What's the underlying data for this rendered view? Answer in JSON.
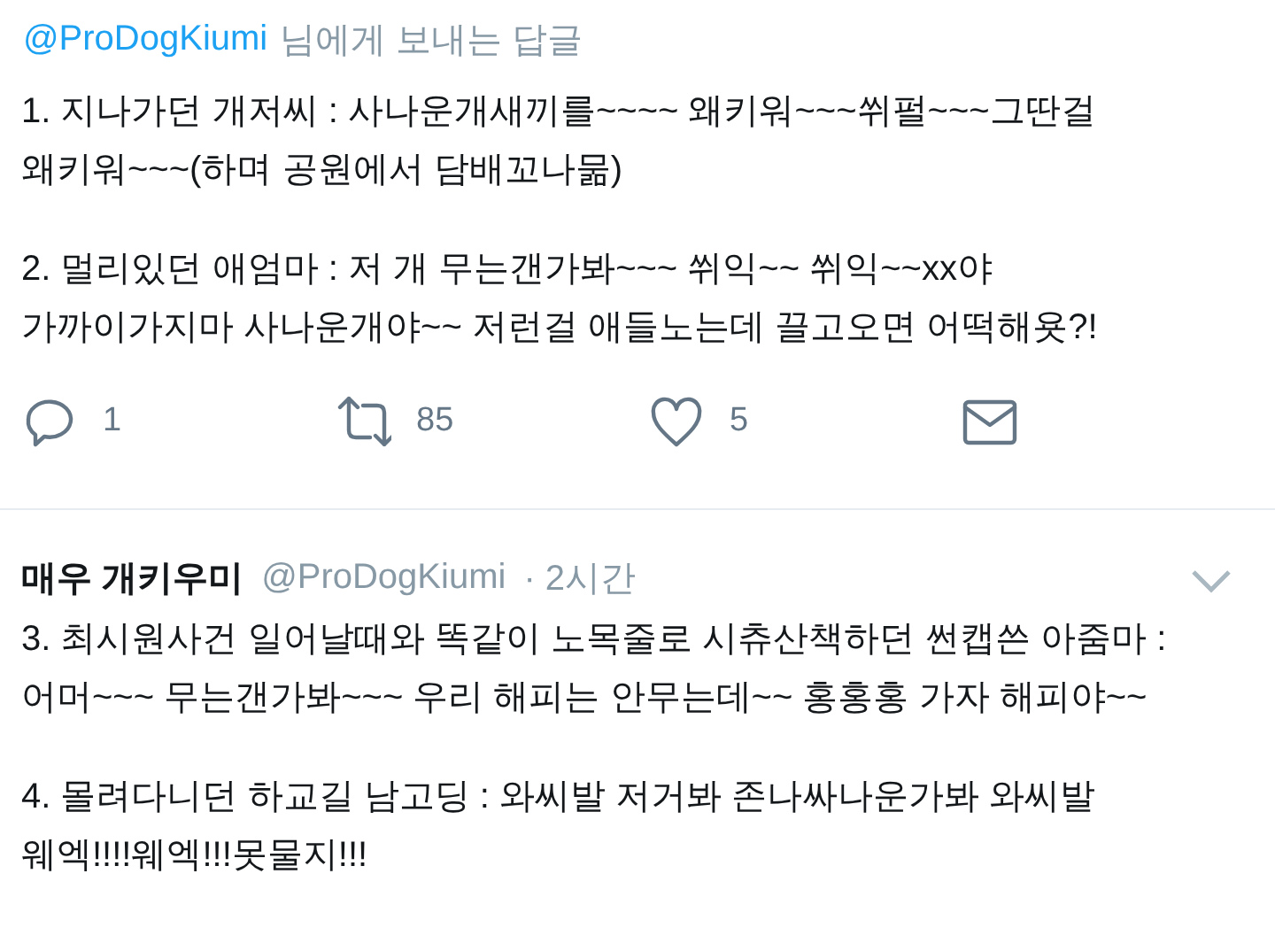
{
  "reply_context": {
    "handle": "@ProDogKiumi",
    "text": "님에게 보내는 답글"
  },
  "tweets": [
    {
      "kind": "reply",
      "paragraphs": [
        "1. 지나가던 개저씨 : 사나운개새끼를~~~~ 왜키워~~~쒸펄~~~그딴걸\n왜키워~~~(하며 공원에서 담배꼬나묾)",
        "2. 멀리있던 애엄마 : 저 개 무는갠가봐~~~ 쒸익~~ 쒸익~~xx야\n가까이가지마 사나운개야~~ 저런걸 애들노는데 끌고오면 어떡해욧?!"
      ],
      "actions": [
        {
          "kind": "reply",
          "count": "1"
        },
        {
          "kind": "retweet",
          "count": "85"
        },
        {
          "kind": "like",
          "count": "5"
        },
        {
          "kind": "message"
        }
      ]
    },
    {
      "kind": "thread",
      "author": {
        "name": "매우 개키우미",
        "handle": "@ProDogKiumi",
        "time": "· 2시간"
      },
      "paragraphs": [
        "3. 최시원사건 일어날때와 똑같이 노목줄로 시츄산책하던 썬캡쓴 아줌마 :\n어머~~~ 무는갠가봐~~~ 우리 해피는 안무는데~~ 홍홍홍 가자 해피야~~",
        "4. 몰려다니던 하교길 남고딩 : 와씨발 저거봐 존나싸나운가봐 와씨발\n웨엑!!!!웨엑!!!못물지!!!"
      ]
    }
  ]
}
